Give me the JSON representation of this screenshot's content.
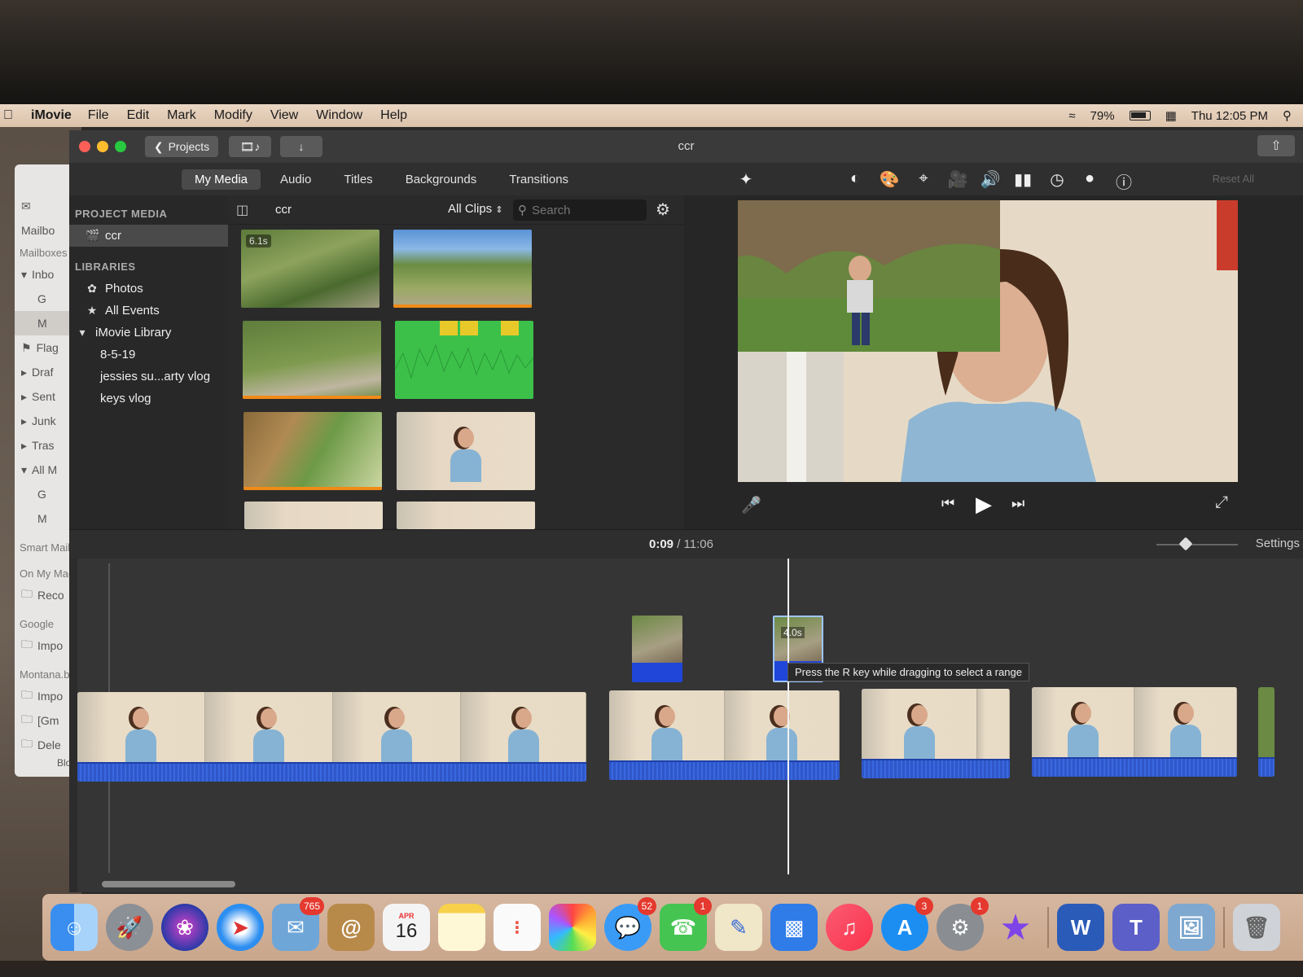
{
  "menubar": {
    "app_name": "iMovie",
    "menus": [
      "File",
      "Edit",
      "Mark",
      "Modify",
      "View",
      "Window",
      "Help"
    ],
    "battery": "79%",
    "clock": "Thu 12:05 PM"
  },
  "mail_sidebar": {
    "items": [
      "Mailbo",
      "Mailboxes",
      "Inbo",
      "G",
      "M",
      "Flag",
      "Draf",
      "Sent",
      "Junk",
      "Tras",
      "All M",
      "G",
      "M",
      "Smart Mail",
      "On My Mac",
      "Reco",
      "Google",
      "Impo",
      "Montana.b",
      "Impo",
      "[Gm",
      "Dele",
      "Bloc"
    ]
  },
  "titlebar": {
    "projects_label": "Projects",
    "title": "ccr"
  },
  "browser_tabs": [
    "My Media",
    "Audio",
    "Titles",
    "Backgrounds",
    "Transitions"
  ],
  "sidebar": {
    "project_media_header": "PROJECT MEDIA",
    "project_item": "ccr",
    "libraries_header": "LIBRARIES",
    "libraries": [
      "Photos",
      "All Events",
      "iMovie Library",
      "8-5-19",
      "jessies su...arty vlog",
      "keys vlog"
    ]
  },
  "browser": {
    "event_title": "ccr",
    "filter": "All Clips",
    "search_placeholder": "Search",
    "first_clip_duration": "6.1s"
  },
  "viewer": {
    "reset_all": "Reset All"
  },
  "timeline": {
    "current_time": "0:09",
    "separator": "/",
    "total_time": "11:06",
    "settings_label": "Settings",
    "selected_clip_duration": "4.0s",
    "tooltip": "Press the R key while dragging to select a range"
  },
  "dock": {
    "mail_badge": "765",
    "calendar_month": "APR",
    "calendar_day": "16",
    "messages_badge": "52",
    "facetime_badge": "1",
    "appstore_badge": "3",
    "prefs_badge": "1",
    "word_letter": "W",
    "teams_letter": "T"
  }
}
